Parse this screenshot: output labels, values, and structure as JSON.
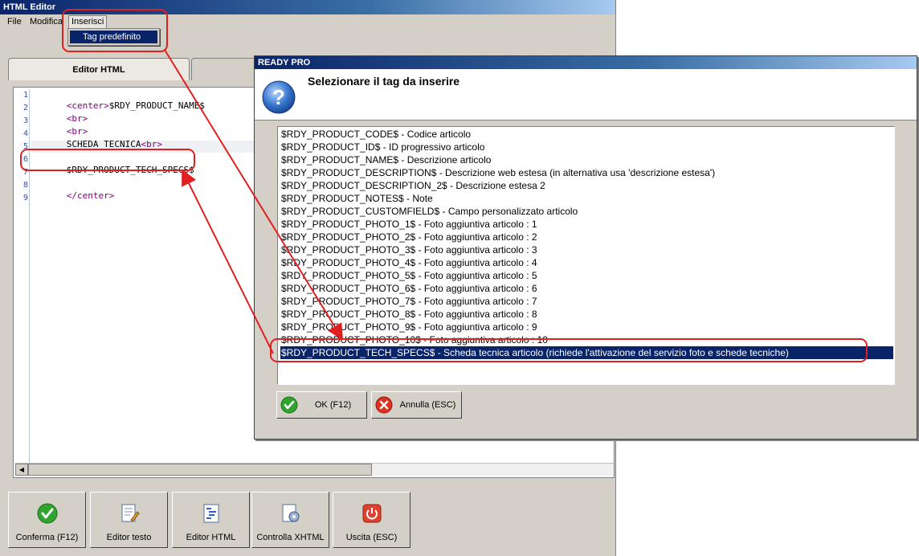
{
  "editor": {
    "title": "HTML Editor",
    "menu": {
      "file": "File",
      "modifica": "Modifica",
      "inserisci": "Inserisci"
    },
    "dropdown": {
      "tag_predefinito": "Tag predefinito"
    },
    "tabs": {
      "editor_html": "Editor HTML"
    },
    "code": {
      "line_numbers": [
        "1",
        "2",
        "3",
        "4",
        "5",
        "6",
        "7",
        "8",
        "9"
      ],
      "l1_tag": "<center>",
      "l1_text": "$RDY_PRODUCT_NAME$",
      "l2_tag": "<br>",
      "l3_tag": "<br>",
      "l4_text": "SCHEDA TECNICA",
      "l4_tag": "<br>",
      "l6_text": "$RDY_PRODUCT_TECH_SPECS$",
      "l8_tag": "</center>"
    },
    "toolbar": {
      "conferma": "Conferma (F12)",
      "editor_testo": "Editor testo",
      "editor_html": "Editor HTML",
      "controlla_xhtml": "Controlla XHTML",
      "uscita": "Uscita (ESC)"
    }
  },
  "dialog": {
    "title": "READY PRO",
    "prompt": "Selezionare il tag da inserire",
    "items": [
      "$RDY_PRODUCT_CODE$ - Codice articolo",
      "$RDY_PRODUCT_ID$ - ID progressivo articolo",
      "$RDY_PRODUCT_NAME$ - Descrizione articolo",
      "$RDY_PRODUCT_DESCRIPTION$ - Descrizione web estesa (in alternativa usa 'descrizione estesa')",
      "$RDY_PRODUCT_DESCRIPTION_2$ - Descrizione estesa 2",
      "$RDY_PRODUCT_NOTES$ - Note",
      "$RDY_PRODUCT_CUSTOMFIELD$ - Campo personalizzato articolo",
      "$RDY_PRODUCT_PHOTO_1$ - Foto aggiuntiva articolo : 1",
      "$RDY_PRODUCT_PHOTO_2$ - Foto aggiuntiva articolo : 2",
      "$RDY_PRODUCT_PHOTO_3$ - Foto aggiuntiva articolo : 3",
      "$RDY_PRODUCT_PHOTO_4$ - Foto aggiuntiva articolo : 4",
      "$RDY_PRODUCT_PHOTO_5$ - Foto aggiuntiva articolo : 5",
      "$RDY_PRODUCT_PHOTO_6$ - Foto aggiuntiva articolo : 6",
      "$RDY_PRODUCT_PHOTO_7$ - Foto aggiuntiva articolo : 7",
      "$RDY_PRODUCT_PHOTO_8$ - Foto aggiuntiva articolo : 8",
      "$RDY_PRODUCT_PHOTO_9$ - Foto aggiuntiva articolo : 9",
      "$RDY_PRODUCT_PHOTO_10$ - Foto aggiuntiva articolo : 10",
      "$RDY_PRODUCT_TECH_SPECS$ - Scheda tecnica articolo (richiede l'attivazione del servizio foto e schede tecniche)"
    ],
    "selected_index": 17,
    "buttons": {
      "ok": "OK (F12)",
      "cancel": "Annulla (ESC)"
    }
  },
  "colors": {
    "selection": "#0a246a",
    "annotation": "#e02020",
    "window_face": "#d4d0c8"
  }
}
